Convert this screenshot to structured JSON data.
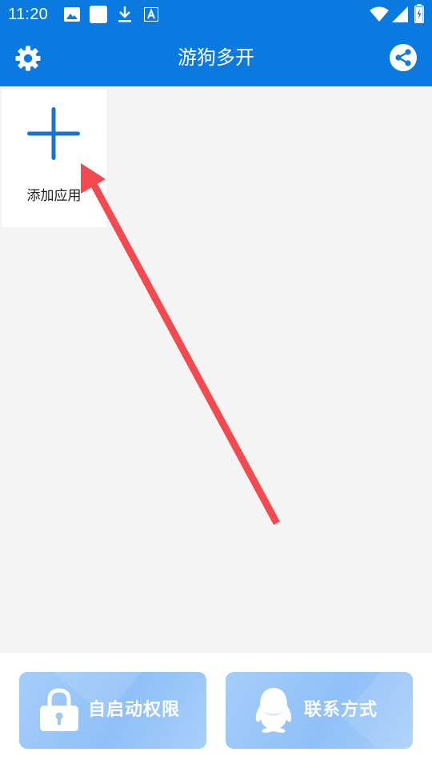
{
  "status_bar": {
    "time": "11:20",
    "icons": [
      "image-icon",
      "notification-square-icon",
      "download-icon",
      "font-a-icon",
      "wifi-icon",
      "signal-icon",
      "battery-charging-icon"
    ]
  },
  "header": {
    "title": "游狗多开",
    "left_icon": "gear-icon",
    "right_icon": "share-icon"
  },
  "main": {
    "add_app_label": "添加应用",
    "add_icon": "plus-icon",
    "guide_arrow_color": "#f24a4f"
  },
  "bottom_bar": {
    "buttons": [
      {
        "label": "自启动权限",
        "icon": "lock-icon"
      },
      {
        "label": "联系方式",
        "icon": "qq-penguin-icon"
      }
    ]
  },
  "colors": {
    "primary": "#0b7ae0",
    "background": "#f4f4f5",
    "button_bg": "#9ec8f9",
    "arrow": "#f24a4f"
  }
}
